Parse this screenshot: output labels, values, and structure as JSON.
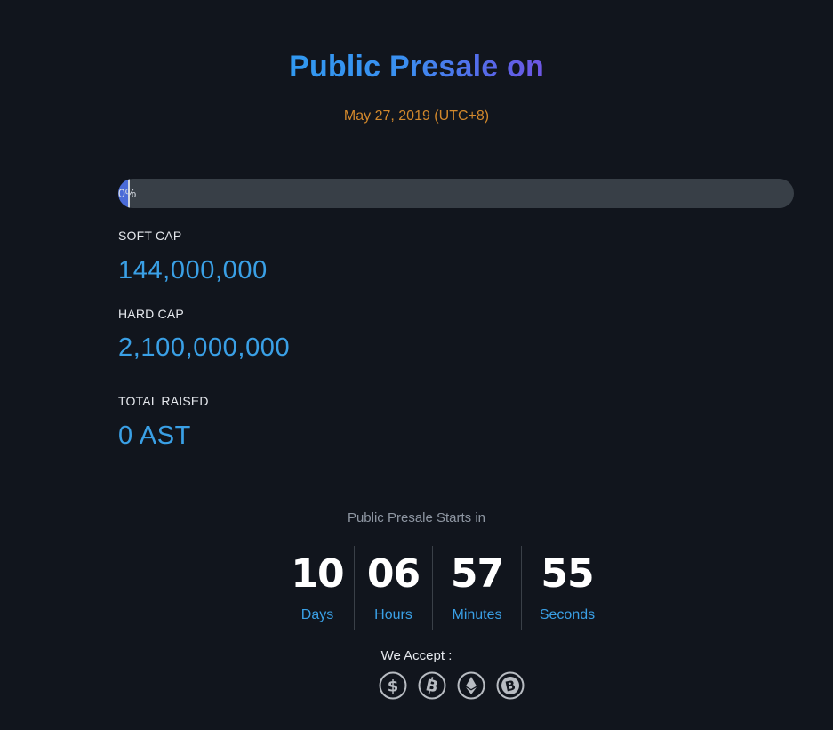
{
  "header": {
    "title": "Public Presale on",
    "date": "May 27, 2019 (UTC+8)"
  },
  "progress": {
    "label": "0%",
    "fraction": 0
  },
  "stats": {
    "soft_cap_label": "SOFT CAP",
    "soft_cap_value": "144,000,000",
    "hard_cap_label": "HARD CAP",
    "hard_cap_value": "2,100,000,000",
    "total_raised_label": "TOTAL RAISED",
    "total_raised_value": "0 AST"
  },
  "countdown": {
    "heading": "Public Presale Starts in",
    "days": "10",
    "days_label": "Days",
    "hours": "06",
    "hours_label": "Hours",
    "minutes": "57",
    "minutes_label": "Minutes",
    "seconds": "55",
    "seconds_label": "Seconds"
  },
  "payment": {
    "label": "We Accept :",
    "icons": [
      "dollar-icon",
      "bitcoin-icon",
      "ethereum-icon",
      "bitcoin-cash-icon"
    ]
  },
  "colors": {
    "background": "#11151d",
    "accent_blue": "#3aa0e6",
    "date_orange": "#d2882c",
    "track": "#383f47"
  }
}
